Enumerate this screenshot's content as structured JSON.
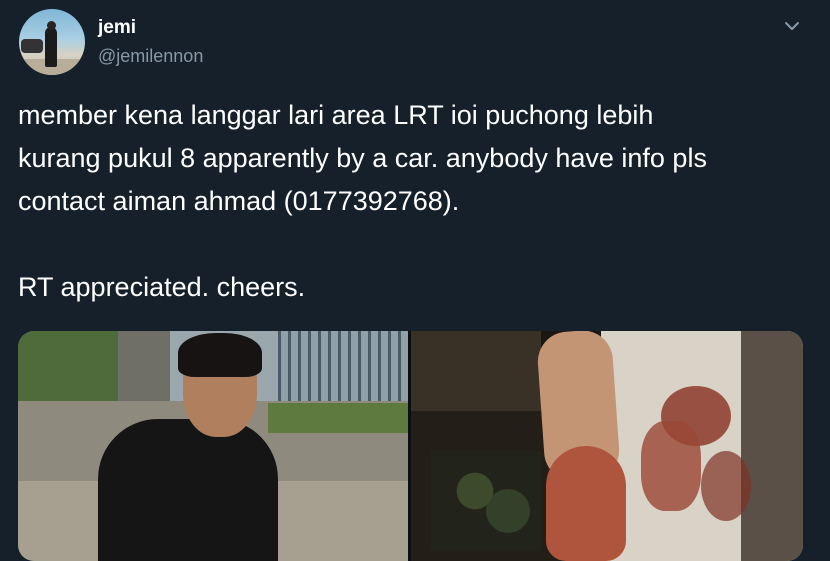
{
  "tweet": {
    "display_name": "jemi",
    "handle": "@jemilennon",
    "text_lines": [
      "member kena langgar lari area LRT ioi puchong lebih",
      "kurang pukul 8 apparently by a car. anybody have info pls",
      "contact aiman ahmad (0177392768)."
    ],
    "text_line2": "RT appreciated. cheers.",
    "icons": {
      "menu": "chevron-down-icon",
      "avatar": "avatar"
    },
    "colors": {
      "background": "#15202b",
      "secondary_text": "#8899a6",
      "primary_text": "#ffffff"
    }
  }
}
